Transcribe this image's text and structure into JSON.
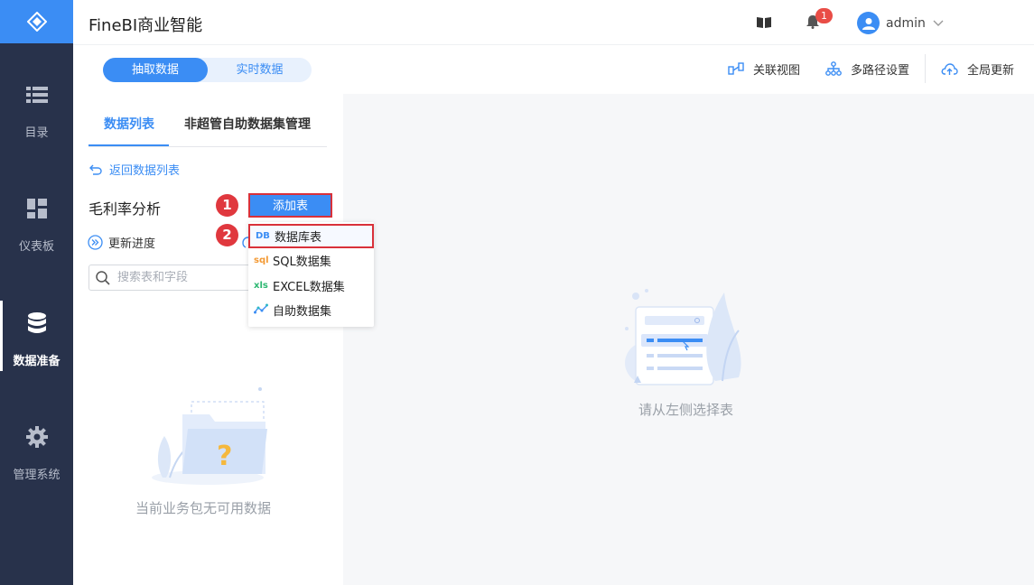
{
  "nav": {
    "items": [
      {
        "label": "目录",
        "icon": "list-icon"
      },
      {
        "label": "仪表板",
        "icon": "dashboard-icon"
      },
      {
        "label": "数据准备",
        "icon": "database-icon"
      },
      {
        "label": "管理系统",
        "icon": "gear-icon"
      }
    ]
  },
  "header": {
    "title": "FineBI商业智能",
    "notification_count": "1",
    "user": "admin"
  },
  "toolbar": {
    "mode_extract": "抽取数据",
    "mode_realtime": "实时数据",
    "relation_view": "关联视图",
    "multipath_settings": "多路径设置",
    "global_update": "全局更新"
  },
  "tabs": {
    "data_list": "数据列表",
    "self_service": "非超管自助数据集管理"
  },
  "panel": {
    "back_link": "返回数据列表",
    "package_title": "毛利率分析",
    "add_table": "添加表",
    "update_progress": "更新进度",
    "search_placeholder": "搜索表和字段",
    "empty_text": "当前业务包无可用数据"
  },
  "steps": {
    "one": "1",
    "two": "2"
  },
  "dropdown": {
    "items": [
      {
        "icon_text": "DB",
        "label": "数据库表",
        "color": "#3b8df4"
      },
      {
        "icon_text": "sql",
        "label": "SQL数据集",
        "color": "#f39a35"
      },
      {
        "icon_text": "xls",
        "label": "EXCEL数据集",
        "color": "#2eb872"
      },
      {
        "icon_text": "",
        "label": "自助数据集",
        "color": "#3b8df4"
      }
    ]
  },
  "right": {
    "empty_text": "请从左侧选择表"
  },
  "colors": {
    "primary": "#3b8df4",
    "nav_bg": "#28324b",
    "highlight": "#d9313a"
  }
}
